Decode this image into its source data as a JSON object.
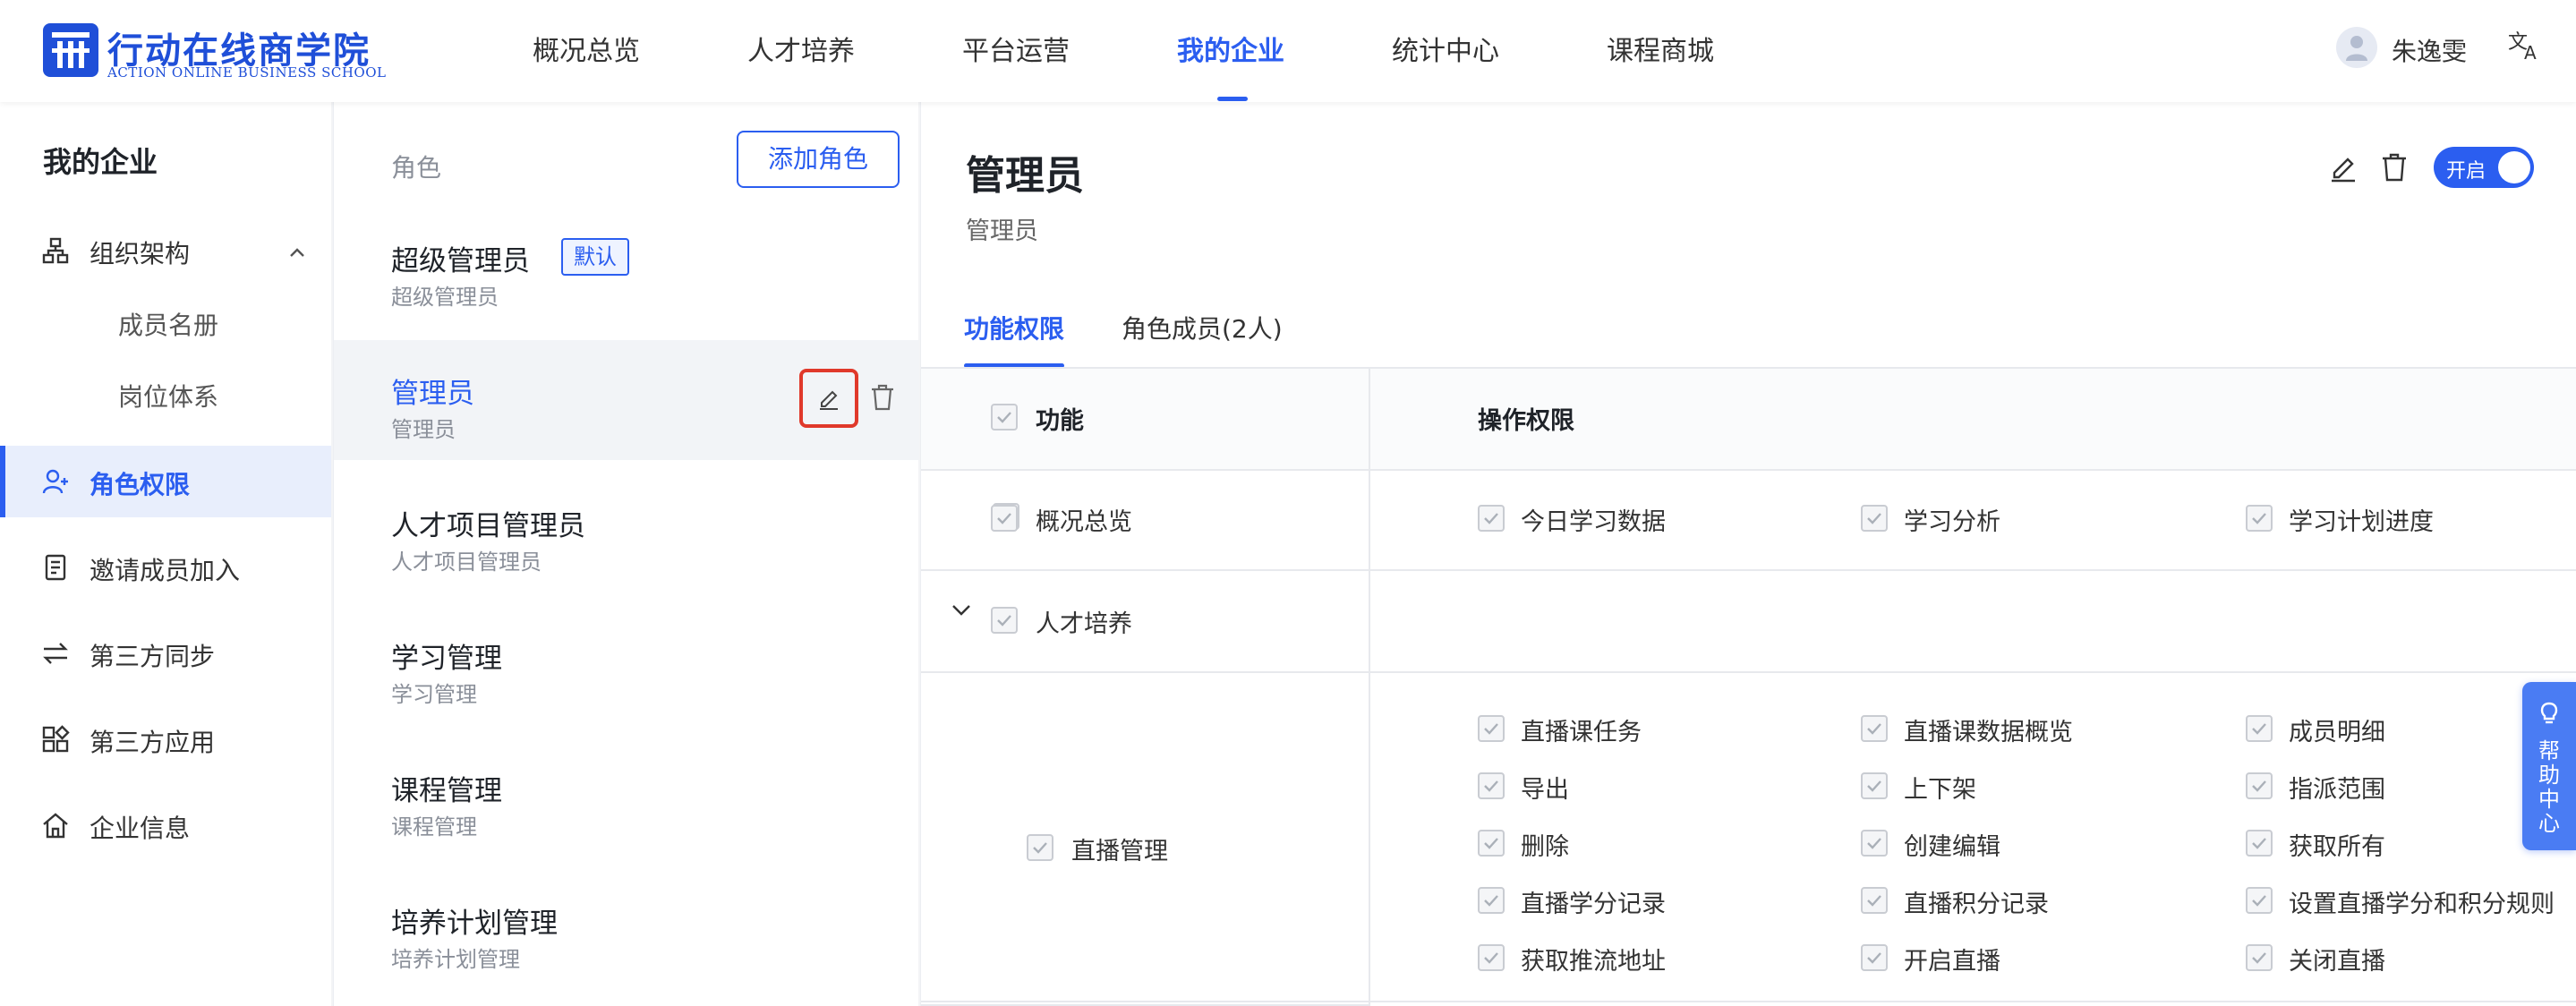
{
  "header": {
    "logo_title": "行动在线商学院",
    "logo_subtitle": "ACTION ONLINE BUSINESS SCHOOL",
    "nav": [
      {
        "label": "概况总览"
      },
      {
        "label": "人才培养"
      },
      {
        "label": "平台运营"
      },
      {
        "label": "我的企业"
      },
      {
        "label": "统计中心"
      },
      {
        "label": "课程商城"
      }
    ],
    "active_nav": "我的企业",
    "user_name": "朱逸雯"
  },
  "sidebar": {
    "title": "我的企业",
    "items": [
      {
        "label": "组织架构",
        "icon": "org-structure-icon",
        "expanded": true
      },
      {
        "label": "成员名册"
      },
      {
        "label": "岗位体系"
      },
      {
        "label": "角色权限",
        "icon": "role-permission-icon",
        "active": true
      },
      {
        "label": "邀请成员加入",
        "icon": "invite-icon"
      },
      {
        "label": "第三方同步",
        "icon": "sync-icon"
      },
      {
        "label": "第三方应用",
        "icon": "apps-icon"
      },
      {
        "label": "企业信息",
        "icon": "home-icon"
      }
    ]
  },
  "roles": {
    "header": "角色",
    "add_label": "添加角色",
    "default_badge": "默认",
    "list": [
      {
        "name": "超级管理员",
        "desc": "超级管理员"
      },
      {
        "name": "管理员",
        "desc": "管理员"
      },
      {
        "name": "人才项目管理员",
        "desc": "人才项目管理员"
      },
      {
        "name": "学习管理",
        "desc": "学习管理"
      },
      {
        "name": "课程管理",
        "desc": "课程管理"
      },
      {
        "name": "培养计划管理",
        "desc": "培养计划管理"
      }
    ]
  },
  "detail": {
    "title": "管理员",
    "subtitle": "管理员",
    "switch_label": "开启",
    "switch_on": true,
    "tabs": [
      {
        "label": "功能权限"
      },
      {
        "label": "角色成员(2人)"
      }
    ],
    "table": {
      "col_function": "功能",
      "col_operations": "操作权限",
      "overview": {
        "name": "概况总览",
        "ops": [
          "今日学习数据",
          "学习分析",
          "学习计划进度"
        ]
      },
      "group_name": "人才培养",
      "live": {
        "name": "直播管理",
        "ops": [
          [
            "直播课任务",
            "直播课数据概览",
            "成员明细"
          ],
          [
            "导出",
            "上下架",
            "指派范围"
          ],
          [
            "删除",
            "创建编辑",
            "获取所有"
          ],
          [
            "直播学分记录",
            "直播积分记录",
            "设置直播学分和积分规则"
          ],
          [
            "获取推流地址",
            "开启直播",
            "关闭直播"
          ]
        ]
      }
    }
  },
  "help": {
    "label": "帮助中心"
  },
  "colors": {
    "accent": "#2b5ef0",
    "highlight_border": "#e0392b"
  }
}
